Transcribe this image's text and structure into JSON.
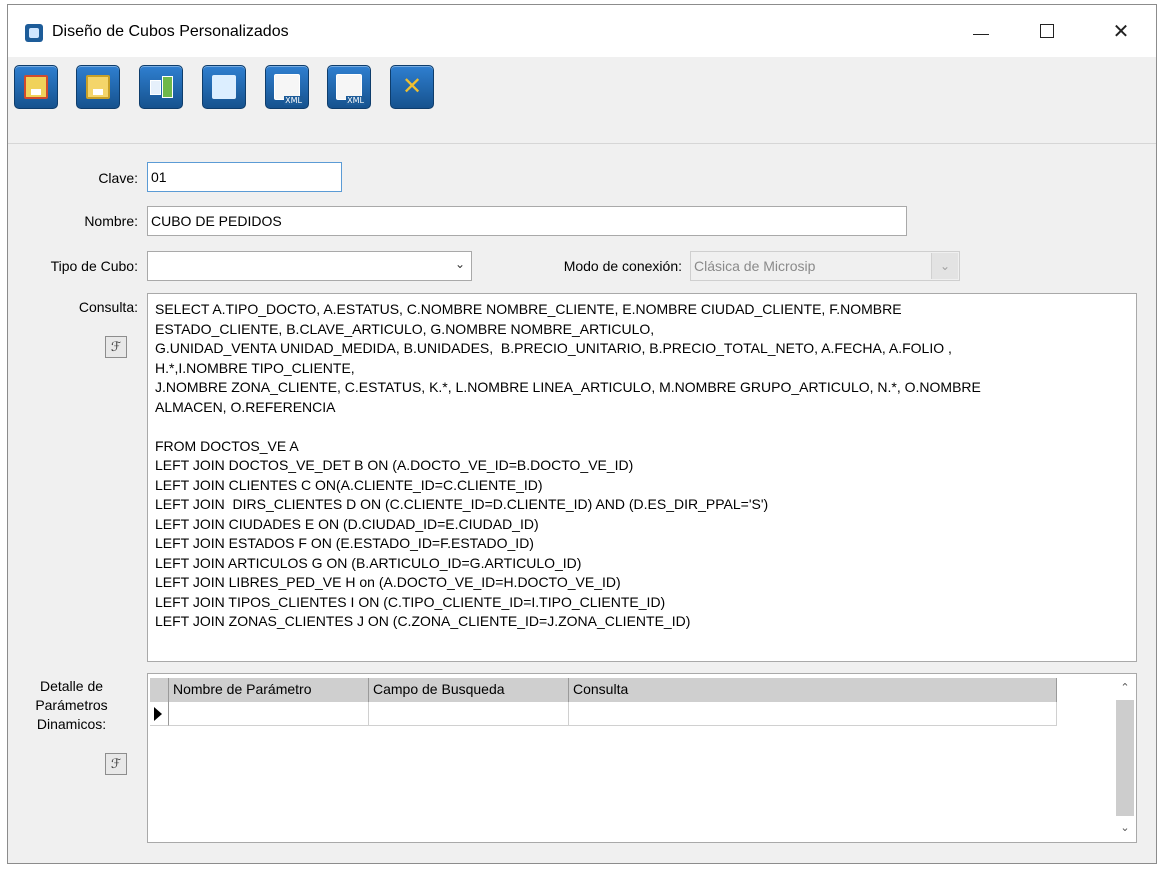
{
  "window": {
    "title": "Diseño de Cubos Personalizados",
    "controls": {
      "minimize": "—",
      "maximize": "☐",
      "close": "✕"
    }
  },
  "toolbar": {
    "buttons": [
      {
        "name": "save-and-close",
        "icon": "save-close-icon"
      },
      {
        "name": "save",
        "icon": "save-icon"
      },
      {
        "name": "design",
        "icon": "tree-icon"
      },
      {
        "name": "cube",
        "icon": "database-icon"
      },
      {
        "name": "import-xml",
        "icon": "xml-import-icon"
      },
      {
        "name": "export-xml",
        "icon": "xml-export-icon"
      },
      {
        "name": "cancel",
        "icon": "cancel-icon"
      }
    ]
  },
  "form": {
    "clave_label": "Clave:",
    "clave_value": "01",
    "nombre_label": "Nombre:",
    "nombre_value": "CUBO DE PEDIDOS",
    "tipo_label": "Tipo de Cubo:",
    "tipo_value": "",
    "modo_label": "Modo de conexión:",
    "modo_value": "Clásica de Microsip",
    "consulta_label": "Consulta:",
    "consulta_lines": [
      "SELECT A.TIPO_DOCTO, A.ESTATUS, C.NOMBRE NOMBRE_CLIENTE, E.NOMBRE CIUDAD_CLIENTE, F.NOMBRE",
      "ESTADO_CLIENTE, B.CLAVE_ARTICULO, G.NOMBRE NOMBRE_ARTICULO,",
      "G.UNIDAD_VENTA UNIDAD_MEDIDA, B.UNIDADES,  B.PRECIO_UNITARIO, B.PRECIO_TOTAL_NETO, A.FECHA, A.FOLIO ,",
      "H.*,I.NOMBRE TIPO_CLIENTE,",
      "J.NOMBRE ZONA_CLIENTE, C.ESTATUS, K.*, L.NOMBRE LINEA_ARTICULO, M.NOMBRE GRUPO_ARTICULO, N.*, O.NOMBRE",
      "ALMACEN, O.REFERENCIA",
      "",
      "FROM DOCTOS_VE A",
      "LEFT JOIN DOCTOS_VE_DET B ON (A.DOCTO_VE_ID=B.DOCTO_VE_ID)",
      "LEFT JOIN CLIENTES C ON(A.CLIENTE_ID=C.CLIENTE_ID)",
      "LEFT JOIN  DIRS_CLIENTES D ON (C.CLIENTE_ID=D.CLIENTE_ID) AND (D.ES_DIR_PPAL='S')",
      "LEFT JOIN CIUDADES E ON (D.CIUDAD_ID=E.CIUDAD_ID)",
      "LEFT JOIN ESTADOS F ON (E.ESTADO_ID=F.ESTADO_ID)",
      "LEFT JOIN ARTICULOS G ON (B.ARTICULO_ID=G.ARTICULO_ID)",
      "LEFT JOIN LIBRES_PED_VE H on (A.DOCTO_VE_ID=H.DOCTO_VE_ID)",
      "LEFT JOIN TIPOS_CLIENTES I ON (C.TIPO_CLIENTE_ID=I.TIPO_CLIENTE_ID)",
      "LEFT JOIN ZONAS_CLIENTES J ON (C.ZONA_CLIENTE_ID=J.ZONA_CLIENTE_ID)"
    ],
    "detalle_label_lines": [
      "Detalle de",
      "Parámetros",
      "Dinamicos:"
    ],
    "sql_button_glyph": "ℱ"
  },
  "grid": {
    "columns": [
      "Nombre de Parámetro",
      "Campo de Busqueda",
      "Consulta"
    ],
    "rows": [
      [
        "",
        "",
        ""
      ]
    ]
  }
}
